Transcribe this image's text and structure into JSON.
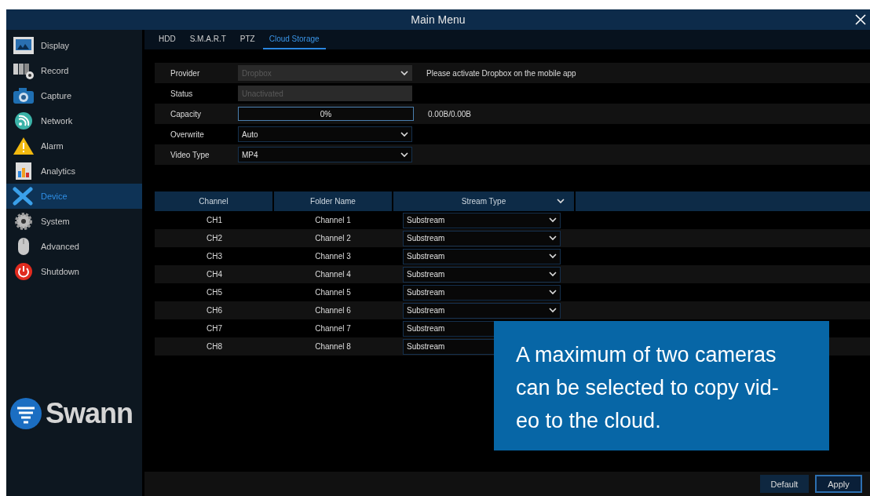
{
  "window": {
    "title": "Main Menu"
  },
  "sidebar": {
    "items": [
      {
        "label": "Display",
        "selected": false
      },
      {
        "label": "Record",
        "selected": false
      },
      {
        "label": "Capture",
        "selected": false
      },
      {
        "label": "Network",
        "selected": false
      },
      {
        "label": "Alarm",
        "selected": false
      },
      {
        "label": "Analytics",
        "selected": false
      },
      {
        "label": "Device",
        "selected": true
      },
      {
        "label": "System",
        "selected": false
      },
      {
        "label": "Advanced",
        "selected": false
      },
      {
        "label": "Shutdown",
        "selected": false
      }
    ],
    "logo": "Swann"
  },
  "tabs": [
    {
      "label": "HDD",
      "selected": false
    },
    {
      "label": "S.M.A.R.T",
      "selected": false
    },
    {
      "label": "PTZ",
      "selected": false
    },
    {
      "label": "Cloud Storage",
      "selected": true
    }
  ],
  "form": [
    {
      "label": "Provider",
      "kind": "select",
      "value": "Dropbox",
      "disabled": true,
      "note": "Please activate Dropbox on the mobile app"
    },
    {
      "label": "Status",
      "kind": "text",
      "value": "Unactivated",
      "disabled": true
    },
    {
      "label": "Capacity",
      "kind": "progress",
      "value": "0%",
      "level": 0,
      "note": "0.00B/0.00B"
    },
    {
      "label": "Overwrite",
      "kind": "select",
      "value": "Auto",
      "disabled": false
    },
    {
      "label": "Video Type",
      "kind": "select",
      "value": "MP4",
      "disabled": false
    }
  ],
  "table": {
    "columns": [
      "Channel",
      "Folder Name",
      "Stream Type"
    ],
    "rows": [
      {
        "channel": "CH1",
        "folder": "Channel 1",
        "stream": "Substream"
      },
      {
        "channel": "CH2",
        "folder": "Channel 2",
        "stream": "Substream"
      },
      {
        "channel": "CH3",
        "folder": "Channel 3",
        "stream": "Substream"
      },
      {
        "channel": "CH4",
        "folder": "Channel 4",
        "stream": "Substream"
      },
      {
        "channel": "CH5",
        "folder": "Channel 5",
        "stream": "Substream"
      },
      {
        "channel": "CH6",
        "folder": "Channel 6",
        "stream": "Substream"
      },
      {
        "channel": "CH7",
        "folder": "Channel 7",
        "stream": "Substream"
      },
      {
        "channel": "CH8",
        "folder": "Channel 8",
        "stream": "Substream"
      }
    ]
  },
  "callout": "A maximum of two cameras can be selected to copy vid-eo to the cloud.",
  "buttons": [
    "Default",
    "Apply"
  ]
}
